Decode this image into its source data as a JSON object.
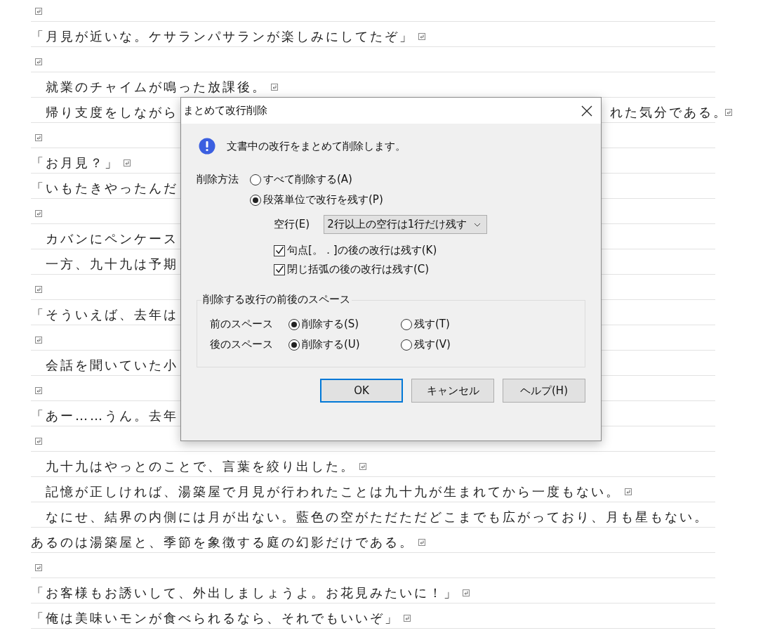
{
  "document": {
    "lines": [
      {
        "indent": false,
        "return_mark": true
      },
      {
        "text": "「月見が近いな。ケサランパサランが楽しみにしてたぞ」",
        "indent": false,
        "return_mark": true
      },
      {
        "indent": false,
        "return_mark": true
      },
      {
        "text": "就業のチャイムが鳴った放課後。",
        "indent": true,
        "return_mark": true
      },
      {
        "text": "帰り支度をしながら",
        "indent": true,
        "tail": "れた気分である。",
        "return_mark": true
      },
      {
        "indent": false,
        "return_mark": true
      },
      {
        "text": "「お月見？」",
        "indent": false,
        "return_mark": true
      },
      {
        "text": "「いもたきやったんだ",
        "indent": false,
        "return_mark": false
      },
      {
        "indent": false,
        "return_mark": true
      },
      {
        "text": "カバンにペンケース",
        "indent": true,
        "return_mark": false
      },
      {
        "text": "一方、九十九は予期",
        "indent": true,
        "return_mark": false
      },
      {
        "indent": false,
        "return_mark": true
      },
      {
        "text": "「そういえば、去年は",
        "indent": false,
        "return_mark": false
      },
      {
        "indent": false,
        "return_mark": true
      },
      {
        "text": "会話を聞いていた小",
        "indent": true,
        "return_mark": false
      },
      {
        "indent": false,
        "return_mark": true
      },
      {
        "text": "「あー……うん。去年",
        "indent": false,
        "return_mark": false
      },
      {
        "indent": false,
        "return_mark": true
      },
      {
        "text": "九十九はやっとのことで、言葉を絞り出した。",
        "indent": true,
        "return_mark": true
      },
      {
        "text": "記憶が正しければ、湯築屋で月見が行われたことは九十九が生まれてから一度もない。",
        "indent": true,
        "return_mark": true
      },
      {
        "text": "なにせ、結界の内側には月が出ない。藍色の空がただただどこまでも広がっており、月も星もない。",
        "indent": true,
        "return_mark": false
      },
      {
        "text": "あるのは湯築屋と、季節を象徴する庭の幻影だけである。",
        "indent": false,
        "return_mark": true
      },
      {
        "indent": false,
        "return_mark": true
      },
      {
        "text": "「お客様もお誘いして、外出しましょうよ。お花見みたいに！」",
        "indent": false,
        "return_mark": true
      },
      {
        "text": "「俺は美味いモンが食べられるなら、それでもいいぞ」",
        "indent": false,
        "return_mark": true
      }
    ]
  },
  "dialog": {
    "title": "まとめて改行削除",
    "message": "文書中の改行をまとめて削除します。",
    "method": {
      "label": "削除方法",
      "options": [
        {
          "label": "すべて削除する(A)",
          "selected": false
        },
        {
          "label": "段落単位で改行を残す(P)",
          "selected": true
        }
      ]
    },
    "blank_lines": {
      "label": "空行(E)",
      "value": "2行以上の空行は1行だけ残す"
    },
    "checkboxes": [
      {
        "label": "句点[。．]の後の改行は残す(K)",
        "checked": true
      },
      {
        "label": "閉じ括弧の後の改行は残す(C)",
        "checked": true
      }
    ],
    "spaces": {
      "title": "削除する改行の前後のスペース",
      "rows": [
        {
          "label": "前のスペース",
          "options": [
            {
              "label": "削除する(S)",
              "selected": true
            },
            {
              "label": "残す(T)",
              "selected": false
            }
          ]
        },
        {
          "label": "後のスペース",
          "options": [
            {
              "label": "削除する(U)",
              "selected": true
            },
            {
              "label": "残す(V)",
              "selected": false
            }
          ]
        }
      ]
    },
    "buttons": [
      {
        "label": "OK",
        "default": true
      },
      {
        "label": "キャンセル",
        "default": false
      },
      {
        "label": "ヘルプ(H)",
        "default": false
      }
    ]
  }
}
